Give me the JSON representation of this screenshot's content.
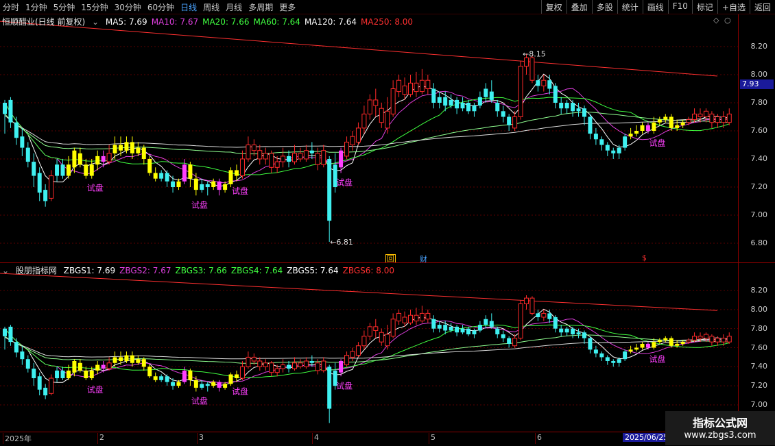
{
  "toolbar": {
    "periods": [
      "分时",
      "1分钟",
      "5分钟",
      "15分钟",
      "30分钟",
      "60分钟",
      "日线",
      "周线",
      "月线",
      "多周期",
      "更多"
    ],
    "active_period": "日线",
    "actions": [
      "复权",
      "叠加",
      "多股",
      "统计",
      "画线",
      "F10",
      "标记",
      "+自选",
      "返回"
    ]
  },
  "main_panel": {
    "title": "恒顺醋业(日线 前复权)",
    "ma": [
      {
        "label": "MA5: 7.69",
        "color": "#ffffff"
      },
      {
        "label": "MA10: 7.67",
        "color": "#e040e0"
      },
      {
        "label": "MA20: 7.66",
        "color": "#40ff40"
      },
      {
        "label": "MA60: 7.64",
        "color": "#40ff40"
      },
      {
        "label": "MA120: 7.64",
        "color": "#ffffff"
      },
      {
        "label": "MA250: 8.00",
        "color": "#ff3030"
      }
    ],
    "y_labels": [
      "8.20",
      "8.00",
      "7.80",
      "7.60",
      "7.40",
      "7.20",
      "7.00",
      "6.80"
    ],
    "current_price": "7.93",
    "high_label": "8.15",
    "low_label": "6.81",
    "signal_text": "试盘",
    "markers": [
      "回",
      "财",
      "$"
    ]
  },
  "sub_panel": {
    "title": "股朋指标网",
    "lines": [
      {
        "label": "ZBGS1: 7.69",
        "color": "#ffffff"
      },
      {
        "label": "ZBGS2: 7.67",
        "color": "#e040e0"
      },
      {
        "label": "ZBGS3: 7.66",
        "color": "#40ff40"
      },
      {
        "label": "ZBGS4: 7.64",
        "color": "#40ff40"
      },
      {
        "label": "ZBGS5: 7.64",
        "color": "#ffffff"
      },
      {
        "label": "ZBGS6: 8.00",
        "color": "#ff3030"
      }
    ],
    "y_labels": [
      "8.20",
      "8.00",
      "7.80",
      "7.60",
      "7.40",
      "7.20",
      "7.00"
    ],
    "signal_text": "试盘"
  },
  "time_axis": {
    "ticks": [
      "2025年",
      "2",
      "3",
      "4",
      "5",
      "6"
    ],
    "cursor_date": "2025/06/25"
  },
  "watermark": {
    "line1": "指标公式网",
    "line2": "www.zbgs3.com"
  },
  "colors": {
    "up": "#ff2a2a",
    "down": "#3ff0f0",
    "trial": "#ffff00",
    "trial_alt": "#ff40ff",
    "ma250": "#ff3030",
    "ma60": "#40ff40",
    "ma120": "#ffffff",
    "ma10": "#e040e0"
  },
  "chart_data": {
    "type": "candlestick",
    "y_range": [
      6.8,
      8.2
    ],
    "candles": [
      [
        7.72,
        7.8,
        7.82,
        7.58,
        "d"
      ],
      [
        7.82,
        7.66,
        7.84,
        7.62,
        "d"
      ],
      [
        7.66,
        7.55,
        7.7,
        7.5,
        "d"
      ],
      [
        7.56,
        7.48,
        7.62,
        7.42,
        "d"
      ],
      [
        7.48,
        7.38,
        7.52,
        7.34,
        "d"
      ],
      [
        7.38,
        7.28,
        7.44,
        7.2,
        "d"
      ],
      [
        7.3,
        7.16,
        7.34,
        7.1,
        "d"
      ],
      [
        7.18,
        7.1,
        7.22,
        7.06,
        "d"
      ],
      [
        7.12,
        7.28,
        7.32,
        7.1,
        "u"
      ],
      [
        7.28,
        7.36,
        7.4,
        7.24,
        "d"
      ],
      [
        7.36,
        7.28,
        7.4,
        7.26,
        "d"
      ],
      [
        7.28,
        7.36,
        7.42,
        7.26,
        "t"
      ],
      [
        7.34,
        7.46,
        7.48,
        7.3,
        "t"
      ],
      [
        7.44,
        7.36,
        7.48,
        7.34,
        "t"
      ],
      [
        7.36,
        7.28,
        7.4,
        7.26,
        "t"
      ],
      [
        7.28,
        7.36,
        7.4,
        7.26,
        "t"
      ],
      [
        7.36,
        7.42,
        7.46,
        7.32,
        "t"
      ],
      [
        7.42,
        7.38,
        7.46,
        7.34,
        "p"
      ],
      [
        7.38,
        7.44,
        7.5,
        7.36,
        "u"
      ],
      [
        7.44,
        7.5,
        7.56,
        7.4,
        "t"
      ],
      [
        7.5,
        7.46,
        7.56,
        7.42,
        "t"
      ],
      [
        7.46,
        7.52,
        7.56,
        7.44,
        "t"
      ],
      [
        7.52,
        7.44,
        7.56,
        7.4,
        "t"
      ],
      [
        7.44,
        7.48,
        7.52,
        7.42,
        "t"
      ],
      [
        7.48,
        7.4,
        7.5,
        7.36,
        "t"
      ],
      [
        7.4,
        7.3,
        7.42,
        7.28,
        "t"
      ],
      [
        7.3,
        7.26,
        7.34,
        7.24,
        "t"
      ],
      [
        7.26,
        7.3,
        7.32,
        7.24,
        "d"
      ],
      [
        7.3,
        7.24,
        7.32,
        7.2,
        "d"
      ],
      [
        7.24,
        7.2,
        7.28,
        7.16,
        "d"
      ],
      [
        7.2,
        7.24,
        7.26,
        7.18,
        "t"
      ],
      [
        7.24,
        7.36,
        7.4,
        7.22,
        "p"
      ],
      [
        7.36,
        7.26,
        7.38,
        7.2,
        "t"
      ],
      [
        7.26,
        7.18,
        7.3,
        7.14,
        "t"
      ],
      [
        7.18,
        7.22,
        7.26,
        7.16,
        "d"
      ],
      [
        7.22,
        7.2,
        7.24,
        7.14,
        "d"
      ],
      [
        7.2,
        7.24,
        7.26,
        7.18,
        "t"
      ],
      [
        7.24,
        7.18,
        7.26,
        7.14,
        "p"
      ],
      [
        7.18,
        7.22,
        7.24,
        7.16,
        "t"
      ],
      [
        7.22,
        7.32,
        7.34,
        7.2,
        "t"
      ],
      [
        7.32,
        7.28,
        7.36,
        7.24,
        "t"
      ],
      [
        7.28,
        7.4,
        7.46,
        7.26,
        "u"
      ],
      [
        7.4,
        7.5,
        7.56,
        7.38,
        "u"
      ],
      [
        7.5,
        7.46,
        7.54,
        7.42,
        "u"
      ],
      [
        7.46,
        7.4,
        7.5,
        7.36,
        "u"
      ],
      [
        7.4,
        7.44,
        7.48,
        7.36,
        "u"
      ],
      [
        7.44,
        7.34,
        7.46,
        7.3,
        "u"
      ],
      [
        7.34,
        7.38,
        7.42,
        7.3,
        "u"
      ],
      [
        7.38,
        7.42,
        7.48,
        7.34,
        "u"
      ],
      [
        7.42,
        7.38,
        7.46,
        7.34,
        "d"
      ],
      [
        7.38,
        7.44,
        7.5,
        7.36,
        "u"
      ],
      [
        7.44,
        7.4,
        7.48,
        7.38,
        "u"
      ],
      [
        7.4,
        7.46,
        7.5,
        7.38,
        "u"
      ],
      [
        7.46,
        7.44,
        7.52,
        7.4,
        "d"
      ],
      [
        7.44,
        7.36,
        7.48,
        7.32,
        "u"
      ],
      [
        7.36,
        7.46,
        7.5,
        7.34,
        "u"
      ],
      [
        7.4,
        6.96,
        7.42,
        6.81,
        "d"
      ],
      [
        7.2,
        7.36,
        7.44,
        7.16,
        "d"
      ],
      [
        7.34,
        7.46,
        7.48,
        7.3,
        "p"
      ],
      [
        7.42,
        7.52,
        7.56,
        7.4,
        "u"
      ],
      [
        7.5,
        7.56,
        7.6,
        7.46,
        "u"
      ],
      [
        7.52,
        7.62,
        7.66,
        7.5,
        "u"
      ],
      [
        7.62,
        7.72,
        7.78,
        7.58,
        "u"
      ],
      [
        7.72,
        7.82,
        7.86,
        7.68,
        "u"
      ],
      [
        7.82,
        7.78,
        7.9,
        7.7,
        "u"
      ],
      [
        7.76,
        7.66,
        7.8,
        7.62,
        "u"
      ],
      [
        7.62,
        7.74,
        7.84,
        7.58,
        "u"
      ],
      [
        7.72,
        7.9,
        7.96,
        7.7,
        "u"
      ],
      [
        7.88,
        7.96,
        8.0,
        7.84,
        "u"
      ],
      [
        7.92,
        7.86,
        7.98,
        7.82,
        "u"
      ],
      [
        7.86,
        7.94,
        8.0,
        7.84,
        "u"
      ],
      [
        7.94,
        7.88,
        8.02,
        7.84,
        "u"
      ],
      [
        7.88,
        7.96,
        8.04,
        7.86,
        "u"
      ],
      [
        7.96,
        7.9,
        8.0,
        7.86,
        "u"
      ],
      [
        7.9,
        7.8,
        7.94,
        7.76,
        "d"
      ],
      [
        7.8,
        7.84,
        7.88,
        7.76,
        "d"
      ],
      [
        7.84,
        7.78,
        7.88,
        7.74,
        "d"
      ],
      [
        7.78,
        7.82,
        7.86,
        7.76,
        "d"
      ],
      [
        7.82,
        7.76,
        7.84,
        7.72,
        "d"
      ],
      [
        7.76,
        7.8,
        7.84,
        7.74,
        "d"
      ],
      [
        7.8,
        7.74,
        7.82,
        7.72,
        "d"
      ],
      [
        7.74,
        7.78,
        7.8,
        7.7,
        "d"
      ],
      [
        7.78,
        7.84,
        7.88,
        7.76,
        "d"
      ],
      [
        7.84,
        7.9,
        7.94,
        7.8,
        "d"
      ],
      [
        7.88,
        7.82,
        7.96,
        7.8,
        "d"
      ],
      [
        7.8,
        7.74,
        7.82,
        7.7,
        "d"
      ],
      [
        7.74,
        7.7,
        7.78,
        7.66,
        "d"
      ],
      [
        7.7,
        7.64,
        7.72,
        7.6,
        "d"
      ],
      [
        7.62,
        7.7,
        7.74,
        7.6,
        "u"
      ],
      [
        7.7,
        8.06,
        8.1,
        7.68,
        "u"
      ],
      [
        8.06,
        8.12,
        8.15,
        8.0,
        "u"
      ],
      [
        8.12,
        7.96,
        8.14,
        7.94,
        "u"
      ],
      [
        7.96,
        7.92,
        8.0,
        7.88,
        "d"
      ],
      [
        7.92,
        7.96,
        8.0,
        7.88,
        "u"
      ],
      [
        7.96,
        7.9,
        8.0,
        7.86,
        "d"
      ],
      [
        7.92,
        7.8,
        7.94,
        7.76,
        "d"
      ],
      [
        7.8,
        7.76,
        7.84,
        7.72,
        "d"
      ],
      [
        7.76,
        7.8,
        7.82,
        7.72,
        "d"
      ],
      [
        7.8,
        7.74,
        7.82,
        7.7,
        "d"
      ],
      [
        7.74,
        7.76,
        7.8,
        7.7,
        "d"
      ],
      [
        7.76,
        7.7,
        7.78,
        7.64,
        "d"
      ],
      [
        7.7,
        7.58,
        7.72,
        7.54,
        "d"
      ],
      [
        7.58,
        7.54,
        7.62,
        7.5,
        "d"
      ],
      [
        7.54,
        7.5,
        7.56,
        7.46,
        "d"
      ],
      [
        7.5,
        7.46,
        7.52,
        7.42,
        "d"
      ],
      [
        7.46,
        7.44,
        7.48,
        7.4,
        "d"
      ],
      [
        7.44,
        7.48,
        7.5,
        7.4,
        "d"
      ],
      [
        7.48,
        7.56,
        7.58,
        7.46,
        "d"
      ],
      [
        7.56,
        7.58,
        7.62,
        7.54,
        "t"
      ],
      [
        7.58,
        7.6,
        7.64,
        7.56,
        "t"
      ],
      [
        7.6,
        7.64,
        7.66,
        7.58,
        "t"
      ],
      [
        7.64,
        7.6,
        7.66,
        7.58,
        "p"
      ],
      [
        7.6,
        7.66,
        7.7,
        7.58,
        "t"
      ],
      [
        7.66,
        7.68,
        7.7,
        7.64,
        "t"
      ],
      [
        7.68,
        7.7,
        7.72,
        7.66,
        "t"
      ],
      [
        7.7,
        7.62,
        7.72,
        7.6,
        "t"
      ],
      [
        7.62,
        7.64,
        7.68,
        7.6,
        "t"
      ],
      [
        7.64,
        7.66,
        7.68,
        7.62,
        "t"
      ],
      [
        7.66,
        7.68,
        7.7,
        7.64,
        "u"
      ],
      [
        7.68,
        7.72,
        7.76,
        7.66,
        "u"
      ],
      [
        7.72,
        7.7,
        7.76,
        7.66,
        "u"
      ],
      [
        7.7,
        7.74,
        7.76,
        7.66,
        "u"
      ],
      [
        7.72,
        7.66,
        7.74,
        7.62,
        "u"
      ],
      [
        7.66,
        7.7,
        7.72,
        7.62,
        "u"
      ],
      [
        7.7,
        7.66,
        7.74,
        7.62,
        "u"
      ],
      [
        7.66,
        7.72,
        7.76,
        7.64,
        "u"
      ]
    ]
  }
}
